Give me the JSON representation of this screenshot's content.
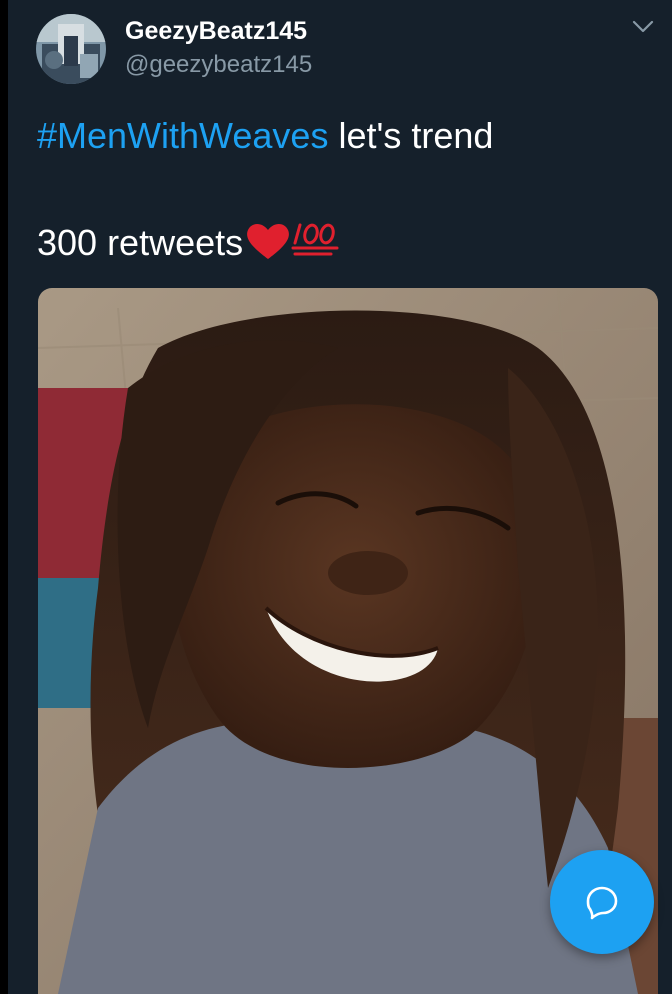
{
  "tweet": {
    "author": {
      "display_name": "GeezyBeatz145",
      "handle": "@geezybeatz145",
      "avatar_icon": "user-avatar"
    },
    "text": {
      "hashtag": "#MenWithWeaves",
      "line1_rest": " let's trend",
      "line2": "300 retweets",
      "emojis": [
        "red-heart",
        "hundred-points"
      ]
    },
    "menu_icon": "chevron-down-icon",
    "media": {
      "type": "photo",
      "subject": "person-selfie"
    }
  },
  "compose_button": {
    "icon": "speech-bubble-icon"
  },
  "colors": {
    "background": "#15202b",
    "outer_border": "#000000",
    "display_name": "#ffffff",
    "handle": "#8899a6",
    "hashtag": "#1da1f2",
    "fab": "#1da1f2"
  }
}
